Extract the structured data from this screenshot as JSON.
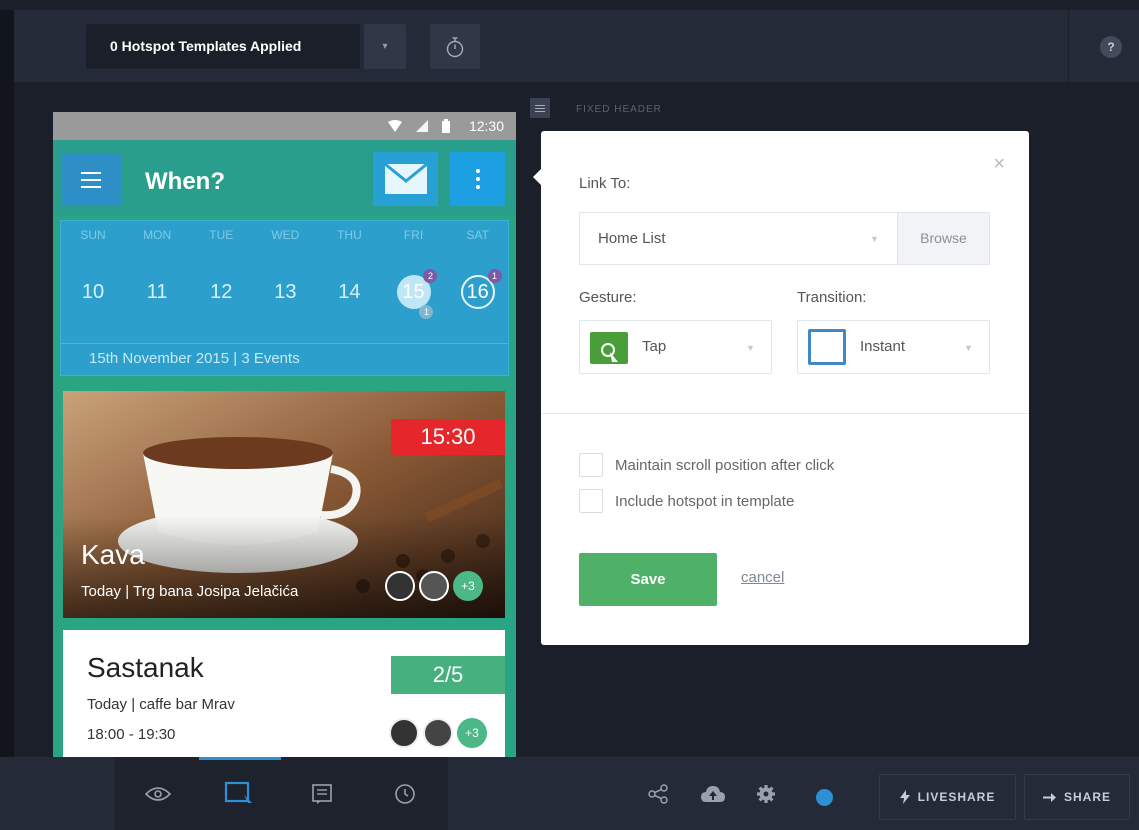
{
  "topbar": {
    "template_label": "0 Hotspot Templates Applied",
    "caret": "▾",
    "help": "?"
  },
  "phone": {
    "status_time": "12:30",
    "app_title": "When?",
    "calendar": {
      "day_names": [
        "SUN",
        "MON",
        "TUE",
        "WED",
        "THU",
        "FRI",
        "SAT"
      ],
      "dates": [
        "10",
        "11",
        "12",
        "13",
        "14",
        "15",
        "16"
      ],
      "badges": {
        "fri_top": "2",
        "fri_bottom": "1",
        "sat_top": "1"
      },
      "info": "15th November 2015  |  3 Events"
    },
    "event": {
      "time": "15:30",
      "title": "Kava",
      "subtitle": "Today | Trg bana Josipa Jelačića",
      "more": "+3"
    },
    "meeting": {
      "title": "Sastanak",
      "place": "Today |  caffe bar Mrav",
      "time": "18:00 - 19:30",
      "count": "2/5",
      "more": "+3"
    }
  },
  "fixed_header_label": "FIXED HEADER",
  "panel": {
    "close": "×",
    "link_to_label": "Link To:",
    "link_value": "Home List",
    "browse_label": "Browse",
    "gesture_label": "Gesture:",
    "gesture_value": "Tap",
    "transition_label": "Transition:",
    "transition_value": "Instant",
    "option_scroll": "Maintain scroll position after click",
    "option_template": "Include hotspot in template",
    "save_label": "Save",
    "cancel_label": "cancel"
  },
  "bottombar": {
    "liveshare_label": "LIVESHARE",
    "share_label": "SHARE"
  },
  "colors": {
    "accent_blue": "#2d8fd6",
    "save_green": "#4fb068",
    "event_red": "#e5262b"
  }
}
